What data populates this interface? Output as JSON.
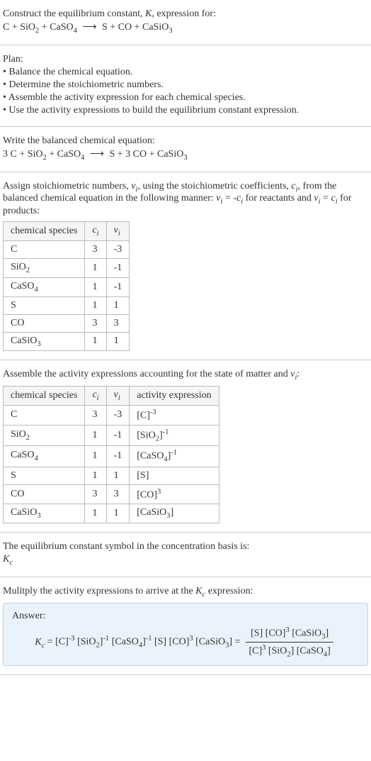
{
  "intro": {
    "heading": "Construct the equilibrium constant, K, expression for:",
    "equation_lhs": "C + SiO₂ + CaSO₄",
    "equation_arrow": "⟶",
    "equation_rhs": "S + CO + CaSiO₃"
  },
  "plan": {
    "heading": "Plan:",
    "bullets": [
      "• Balance the chemical equation.",
      "• Determine the stoichiometric numbers.",
      "• Assemble the activity expression for each chemical species.",
      "• Use the activity expressions to build the equilibrium constant expression."
    ]
  },
  "balanced": {
    "heading": "Write the balanced chemical equation:",
    "equation_lhs": "3 C + SiO₂ + CaSO₄",
    "equation_arrow": "⟶",
    "equation_rhs": "S + 3 CO + CaSiO₃"
  },
  "stoich": {
    "heading_a": "Assign stoichiometric numbers, νᵢ, using the stoichiometric coefficients, cᵢ, from the balanced chemical equation in the following manner: νᵢ = -cᵢ for reactants and νᵢ = cᵢ for products:",
    "table": {
      "headers": [
        "chemical species",
        "cᵢ",
        "νᵢ"
      ],
      "rows": [
        [
          "C",
          "3",
          "-3"
        ],
        [
          "SiO₂",
          "1",
          "-1"
        ],
        [
          "CaSO₄",
          "1",
          "-1"
        ],
        [
          "S",
          "1",
          "1"
        ],
        [
          "CO",
          "3",
          "3"
        ],
        [
          "CaSiO₃",
          "1",
          "1"
        ]
      ]
    }
  },
  "activity": {
    "heading": "Assemble the activity expressions accounting for the state of matter and νᵢ:",
    "table": {
      "headers": [
        "chemical species",
        "cᵢ",
        "νᵢ",
        "activity expression"
      ],
      "rows": [
        {
          "sp": "C",
          "c": "3",
          "v": "-3",
          "expr": "[C]⁻³"
        },
        {
          "sp": "SiO₂",
          "c": "1",
          "v": "-1",
          "expr": "[SiO₂]⁻¹"
        },
        {
          "sp": "CaSO₄",
          "c": "1",
          "v": "-1",
          "expr": "[CaSO₄]⁻¹"
        },
        {
          "sp": "S",
          "c": "1",
          "v": "1",
          "expr": "[S]"
        },
        {
          "sp": "CO",
          "c": "3",
          "v": "3",
          "expr": "[CO]³"
        },
        {
          "sp": "CaSiO₃",
          "c": "1",
          "v": "1",
          "expr": "[CaSiO₃]"
        }
      ]
    }
  },
  "symbol": {
    "heading": "The equilibrium constant symbol in the concentration basis is:",
    "value": "K𝑐"
  },
  "final": {
    "heading": "Mulitply the activity expressions to arrive at the K𝑐 expression:",
    "answer_label": "Answer:",
    "lhs": "K𝑐 = [C]⁻³ [SiO₂]⁻¹ [CaSO₄]⁻¹ [S] [CO]³ [CaSiO₃] =",
    "frac_num": "[S] [CO]³ [CaSiO₃]",
    "frac_den": "[C]³ [SiO₂] [CaSO₄]"
  }
}
